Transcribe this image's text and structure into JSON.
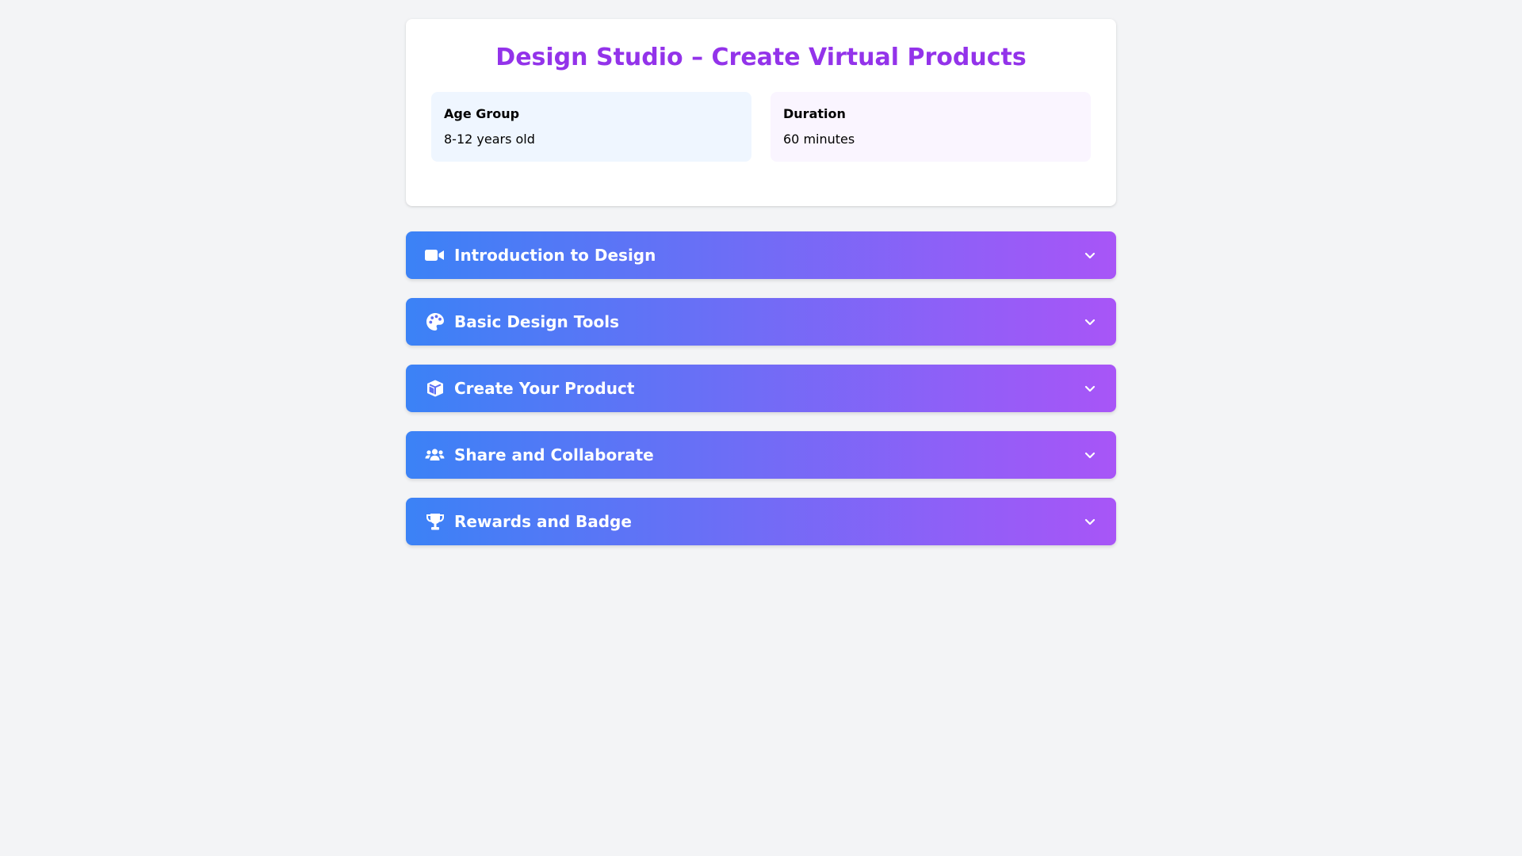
{
  "header": {
    "title": "Design Studio – Create Virtual Products"
  },
  "info": {
    "age_group": {
      "label": "Age Group",
      "value": "8-12 years old"
    },
    "duration": {
      "label": "Duration",
      "value": "60 minutes"
    }
  },
  "sections": [
    {
      "title": "Introduction to Design",
      "icon": "video-icon"
    },
    {
      "title": "Basic Design Tools",
      "icon": "palette-icon"
    },
    {
      "title": "Create Your Product",
      "icon": "cube-icon"
    },
    {
      "title": "Share and Collaborate",
      "icon": "users-icon"
    },
    {
      "title": "Rewards and Badge",
      "icon": "trophy-icon"
    }
  ],
  "colors": {
    "title": "#9333ea",
    "gradient_start": "#3b82f6",
    "gradient_end": "#a855f7",
    "background": "#f3f4f6"
  }
}
